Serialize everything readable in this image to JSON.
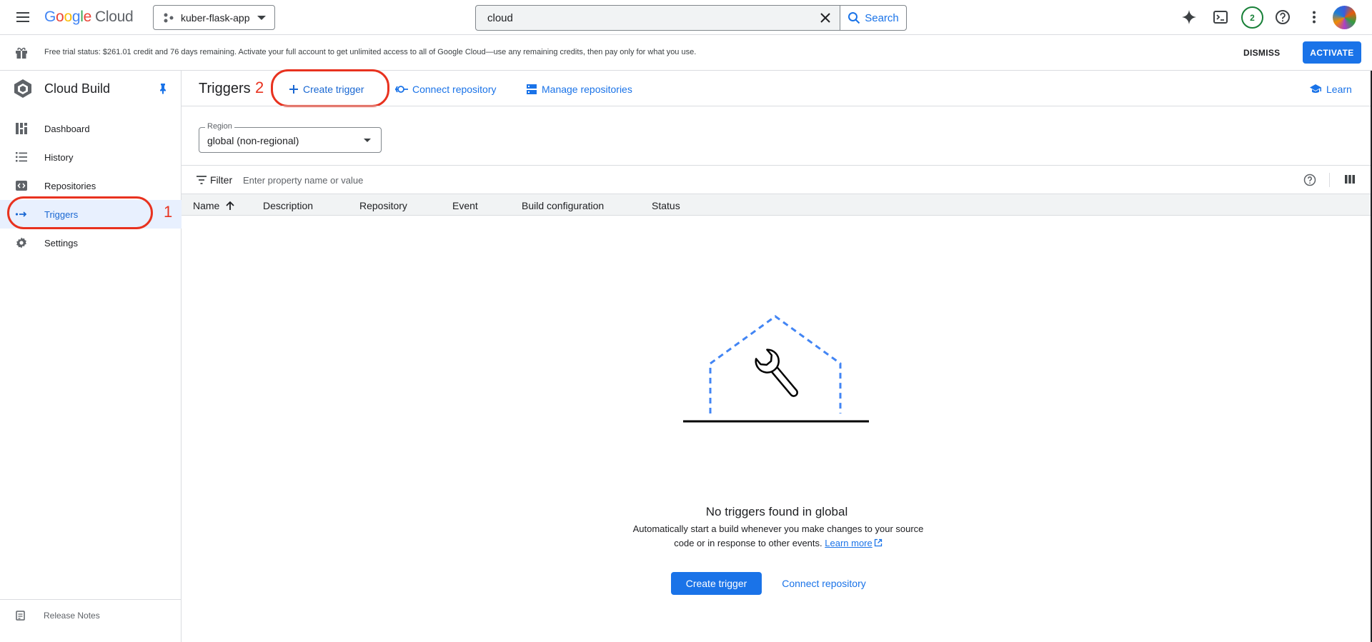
{
  "topbar": {
    "logo_google": "Google",
    "logo_cloud": "Cloud",
    "project": "kuber-flask-app",
    "search_value": "cloud",
    "search_label": "Search",
    "notifications_count": "2"
  },
  "banner": {
    "text": "Free trial status: $261.01 credit and 76 days remaining. Activate your full account to get unlimited access to all of Google Cloud—use any remaining credits, then pay only for what you use.",
    "dismiss": "DISMISS",
    "activate": "ACTIVATE"
  },
  "sidebar": {
    "product_title": "Cloud Build",
    "items": [
      {
        "label": "Dashboard",
        "icon": "dashboard-icon"
      },
      {
        "label": "History",
        "icon": "list-icon"
      },
      {
        "label": "Repositories",
        "icon": "repository-icon"
      },
      {
        "label": "Triggers",
        "icon": "trigger-arrows-icon",
        "active": true
      },
      {
        "label": "Settings",
        "icon": "gear-icon"
      }
    ],
    "release_notes": "Release Notes"
  },
  "annotations": {
    "one": "1",
    "two": "2"
  },
  "main": {
    "page_title": "Triggers",
    "actions": {
      "create_trigger": "Create trigger",
      "connect_repository": "Connect repository",
      "manage_repositories": "Manage repositories",
      "learn": "Learn"
    },
    "region": {
      "label": "Region",
      "value": "global (non-regional)"
    },
    "filter": {
      "label": "Filter",
      "placeholder": "Enter property name or value"
    },
    "table": {
      "columns": [
        "Name",
        "Description",
        "Repository",
        "Event",
        "Build configuration",
        "Status"
      ]
    },
    "empty_state": {
      "title": "No triggers found in global",
      "description_line1": "Automatically start a build whenever you make changes to your source",
      "description_line2": "code or in response to other events.",
      "learn_more": "Learn more",
      "primary_button": "Create trigger",
      "secondary_button": "Connect repository"
    }
  },
  "colors": {
    "accent": "#1a73e8",
    "annotation_red": "#e8321f",
    "active_nav_bg": "#e8f0fe",
    "notification_green": "#188038"
  }
}
